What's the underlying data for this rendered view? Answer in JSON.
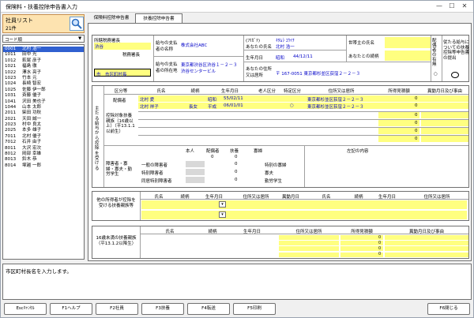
{
  "window": {
    "title": "保険料・扶養控除申告書入力",
    "minimize": "—",
    "maximize": "☐",
    "close": "✕"
  },
  "employee_list": {
    "title": "社員リスト",
    "count": "21件",
    "sort": "コード順",
    "items": [
      {
        "code": "0001",
        "name": "北村 浩一"
      },
      {
        "code": "1011",
        "name": "田中 光"
      },
      {
        "code": "1012",
        "name": "萩尾 彦子"
      },
      {
        "code": "1021",
        "name": "福島 徹"
      },
      {
        "code": "1022",
        "name": "澤水 亮子"
      },
      {
        "code": "1023",
        "name": "竹本 元"
      },
      {
        "code": "1024",
        "name": "長崎 智宏"
      },
      {
        "code": "1025",
        "name": "佐藤 伊一郎"
      },
      {
        "code": "1031",
        "name": "斉藤 優子"
      },
      {
        "code": "1041",
        "name": "沢田 美也子"
      },
      {
        "code": "1044",
        "name": "山本 太郎"
      },
      {
        "code": "2011",
        "name": "柴田 功秋"
      },
      {
        "code": "2021",
        "name": "天田 誠一"
      },
      {
        "code": "2023",
        "name": "村中 良太"
      },
      {
        "code": "2025",
        "name": "本多 雄子"
      },
      {
        "code": "7011",
        "name": "北村 優子"
      },
      {
        "code": "7012",
        "name": "石井 由子"
      },
      {
        "code": "8011",
        "name": "大沢 宏次"
      },
      {
        "code": "8012",
        "name": "岡部 幸雄"
      },
      {
        "code": "8013",
        "name": "鈴木 恭"
      },
      {
        "code": "8014",
        "name": "塚越 一郎"
      }
    ]
  },
  "tabs": [
    "保険料控除申告書",
    "扶養控除申告書"
  ],
  "header": {
    "tax_office_label": "所轄税務署長",
    "tax_office_value": "渋谷",
    "tax_office_suffix": "税務署長",
    "city_value": "市　市区町村長",
    "city_suffix": "",
    "payer_name_label": "給与の支払者の名称",
    "payer_name_value": "株式会社ABC",
    "payer_addr_label": "給与の支払者の所在地",
    "payer_addr_value1": "東京都渋谷区渋谷１－２－３",
    "payer_addr_value2": "渋谷センタービル",
    "kana_label": "(ﾌﾘｶﾞﾅ)",
    "kana_value": "ｷﾀﾑﾗ ｺｳｲﾁ",
    "name_label": "あなたの氏名",
    "name_value": "北村 浩一",
    "birth_label": "生年月日",
    "birth_era": "昭和",
    "birth_value": "44/12/11",
    "addr_label": "あなたの住所又は居所",
    "addr_value": "〒 167-0051 東京都杉並区荻窪２－２－３",
    "householder_label": "世帯主の氏名",
    "relation_label": "あなたとの続柄",
    "spouse_label": "配偶者の有無",
    "spouse_value": "○",
    "other_payer_label": "従たる給与についての扶養控除等申告書の提出"
  },
  "dependents": {
    "side_label": "主たる給与から控除を受ける",
    "cols": [
      "区分等",
      "氏名",
      "続柄",
      "生年月日",
      "老人区分",
      "特定区分",
      "住所又は居所",
      "所得見積額",
      "異動月日及び事由"
    ],
    "spouse_label": "配偶者",
    "rows": [
      {
        "name": "北村 愛",
        "relation": "",
        "era": "昭和",
        "birth": "55/02/11",
        "old": "",
        "special": "",
        "address": "東京都杉並区荻窪２－２－３",
        "income": "0"
      },
      {
        "name": "北村 祥子",
        "relation": "長女",
        "era": "平成",
        "birth": "06/01/01",
        "old": "",
        "special": "○",
        "address": "東京都杉並区荻窪２－２－３",
        "income": "0"
      }
    ],
    "dep_label": "控除対象扶養親族（16歳以上）（平13.1.1以前生）",
    "empty_incomes": [
      "0",
      "0",
      "0",
      "0"
    ],
    "disabled_label": "障害者・寡婦・寡夫・勤労学生",
    "sub_cols": [
      "本人",
      "配偶者",
      "扶養",
      "寡婦"
    ],
    "counts": [
      "0",
      "0"
    ],
    "disabled_rows": [
      {
        "label": "一般の障害者",
        "count": "0",
        "right": "特別の寡婦"
      },
      {
        "label": "特別障害者",
        "count": "0",
        "right": "寡夫"
      },
      {
        "label": "同居特別障害者",
        "count": "0",
        "right": "勤労学生"
      }
    ],
    "remarks_label": "左記の内容"
  },
  "other_payer": {
    "side_label": "他の所得者が控除を受ける扶養親族等",
    "cols": [
      "氏名",
      "続柄",
      "生年月日",
      "住所又は居所",
      "異動月日",
      "氏名",
      "続柄",
      "生年月日",
      "住所又は居所"
    ]
  },
  "under16": {
    "side_label": "16歳未満の扶養親族（平13.1.2以降生）",
    "cols": [
      "氏名",
      "続柄",
      "生年月日",
      "住所又は居所",
      "所得見積額",
      "異動月日及び事由"
    ],
    "incomes": [
      "0",
      "0",
      "0",
      "0"
    ]
  },
  "status_message": "市区町村長名を入力します。",
  "fkeys": [
    "Escｷｬﾝｾﾙ",
    "F1ヘルプ",
    "F2社員",
    "F3扶養",
    "F4転送",
    "F5印刷",
    "F6閉じる"
  ]
}
